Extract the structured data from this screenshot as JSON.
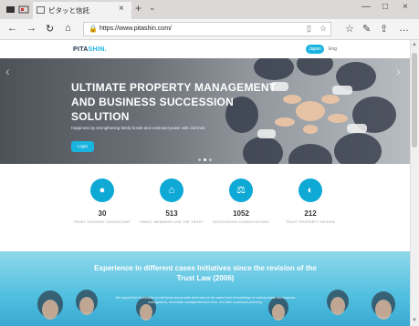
{
  "browser": {
    "tab_title": "ピタッと信託",
    "url": "https://www.pitashin.com/",
    "tab_close": "×",
    "new_tab": "+",
    "tab_menu": "⌄",
    "nav": {
      "back": "←",
      "forward": "→",
      "reload": "↻",
      "home": "⌂"
    },
    "window": {
      "minimize": "—",
      "maximize": "□",
      "close": "×"
    }
  },
  "site": {
    "logo_main": "PITA",
    "logo_accent": "SHIN.",
    "lang_active": "Japan",
    "lang_other": "Eng",
    "hero": {
      "title": "ULTIMATE PROPERTY MANAGEMENT AND BUSINESS SUCCESSION SOLUTION",
      "subtitle": "Happiness by strengthening family bonds and continued power with civil trust",
      "button": "Login",
      "prev": "‹",
      "next": "›"
    },
    "stats": [
      {
        "icon": "user-icon",
        "glyph": "●",
        "value": "30",
        "label": "TRUST CONSENT CONSULTANT"
      },
      {
        "icon": "bank-icon",
        "glyph": "⌂",
        "value": "513",
        "label": "FAMILY MEMBERS USE THE TRUST"
      },
      {
        "icon": "scale-icon",
        "glyph": "⚖",
        "value": "1052",
        "label": "SUCCESSION CONSULTATIONS"
      },
      {
        "icon": "shield-icon",
        "glyph": "◐",
        "value": "212",
        "label": "TRUST PROPERTY REVIEW"
      }
    ],
    "section2": {
      "title": "Experience in different cases Initiatives since the revision of the Trust Law (2006)",
      "body": "We support the introduction of civil trusts and provide civil trusts on the same level of knowledge of various estate and business management, real estate management and more, and wide succession planning."
    }
  },
  "colors": {
    "accent": "#1ab4e0",
    "stat_circle": "#0fa9d6"
  }
}
